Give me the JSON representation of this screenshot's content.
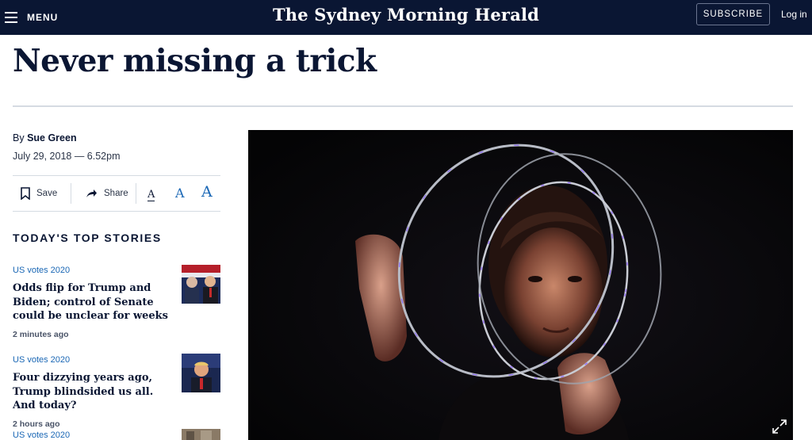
{
  "header": {
    "menu_label": "MENU",
    "masthead": "The Sydney Morning Herald",
    "subscribe_label": "SUBSCRIBE",
    "login_label": "Log in",
    "background": "#0a1633"
  },
  "article": {
    "headline": "Never missing a trick",
    "byline_prefix": "By ",
    "author": "Sue Green",
    "published": "July 29, 2018 — 6.52pm"
  },
  "actions": {
    "save_label": "Save",
    "share_label": "Share",
    "font_sizes": [
      "A",
      "A",
      "A"
    ]
  },
  "top_stories": {
    "title": "TODAY'S TOP STORIES",
    "items": [
      {
        "category": "US votes 2020",
        "title": "Odds flip for Trump and Biden; control of Senate could be unclear for weeks",
        "time": "2 minutes ago"
      },
      {
        "category": "US votes 2020",
        "title": "Four dizzying years ago, Trump blindsided us all. And today?",
        "time": "2 hours ago"
      },
      {
        "category": "US votes 2020",
        "title": "",
        "time": ""
      }
    ]
  },
  "colors": {
    "navy": "#0a1633",
    "link_blue": "#1a67b5",
    "rule": "#d5dbe2"
  }
}
